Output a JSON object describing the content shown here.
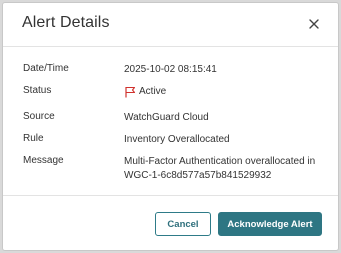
{
  "dialog": {
    "title": "Alert Details",
    "close_icon": "close-icon"
  },
  "details": {
    "date_time": {
      "label": "Date/Time",
      "value": "2025-10-02 08:15:41"
    },
    "status": {
      "label": "Status",
      "value": "Active",
      "icon": "flag-icon",
      "icon_color": "#d0312d"
    },
    "source": {
      "label": "Source",
      "value": "WatchGuard Cloud"
    },
    "rule": {
      "label": "Rule",
      "value": "Inventory Overallocated"
    },
    "message": {
      "label": "Message",
      "value": "Multi-Factor Authentication overallocated in WGC-1-6c8d577a57b841529932"
    }
  },
  "buttons": {
    "cancel_label": "Cancel",
    "acknowledge_label": "Acknowledge Alert",
    "accent_color": "#2e7683"
  }
}
